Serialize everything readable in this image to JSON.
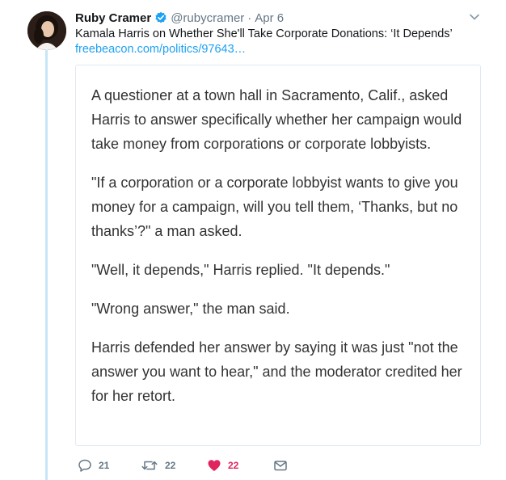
{
  "tweet": {
    "author_name": "Ruby Cramer",
    "handle": "@rubycramer",
    "separator": "·",
    "date": "Apr 6",
    "text": "Kamala Harris on Whether She'll Take Corporate Donations: ‘It Depends’",
    "link_text": "freebeacon.com/politics/97643…"
  },
  "quote": {
    "paragraphs": [
      "A questioner at a town hall in Sacramento, Calif., asked Harris to answer specifically whether her campaign would take money from corporations or corporate lobbyists.",
      "\"If a corporation or a corporate lobbyist wants to give you money for a campaign, will you tell them, ‘Thanks, but no thanks’?\" a man asked.",
      "\"Well, it depends,\" Harris replied. \"It depends.\"",
      "\"Wrong answer,\" the man said.",
      "Harris defended her answer by saying it was just \"not the answer you want to hear,\" and the moderator credited her for her retort."
    ]
  },
  "actions": {
    "reply_count": "21",
    "retweet_count": "22",
    "like_count": "22",
    "liked": true
  },
  "colors": {
    "link": "#1da1f2",
    "muted": "#657786",
    "like": "#e0245e",
    "thread_line": "#c4e6f7",
    "verified": "#1da1f2"
  },
  "icons": {
    "verified": "verified-badge-icon",
    "caret": "chevron-down-icon",
    "reply": "reply-icon",
    "retweet": "retweet-icon",
    "like": "heart-icon",
    "dm": "envelope-icon"
  }
}
